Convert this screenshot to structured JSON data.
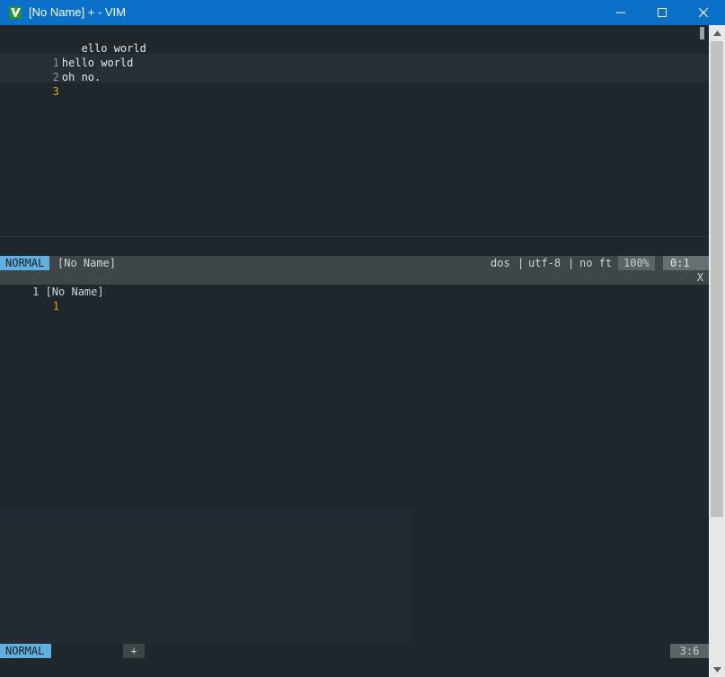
{
  "window": {
    "title": "[No Name] + - VIM",
    "accent": "#0a70c8"
  },
  "buffer_top": {
    "lines": [
      {
        "num": "",
        "text": "   ello world"
      },
      {
        "num": "1",
        "text": "hello world"
      },
      {
        "num": "2",
        "text": "oh no."
      },
      {
        "num": "3",
        "text": ""
      }
    ]
  },
  "status_top": {
    "mode": "NORMAL",
    "filename": "[No Name]",
    "format": "dos",
    "encoding": "utf-8",
    "filetype": "no ft",
    "percent": "100%",
    "position": "0:1"
  },
  "quickfix": {
    "label": " 1 [No Name]",
    "close": "X",
    "line_num": "1"
  },
  "status_bottom": {
    "mode": "NORMAL",
    "plus": "+",
    "position": "3:6"
  },
  "colors": {
    "mode_bg": "#5fafe0",
    "cursor_line_number": "#e0a01c",
    "terminal_bg": "#1f272c"
  }
}
